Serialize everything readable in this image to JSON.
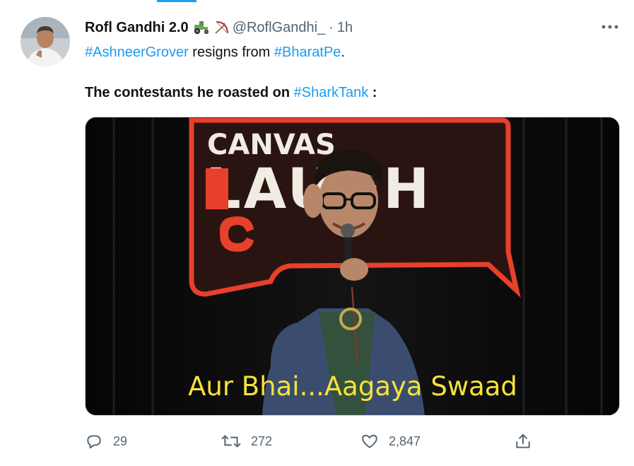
{
  "tweet": {
    "author": {
      "display_name": "Rofl Gandhi 2.0",
      "emojis": [
        "tractor-emoji",
        "bow-and-arrow-emoji"
      ],
      "handle": "@RoflGandhi_",
      "separator": "·",
      "timestamp": "1h"
    },
    "body": {
      "line1": {
        "hashtag1": "#AshneerGrover",
        "middle": " resigns from ",
        "hashtag2": "#BharatPe",
        "end": "."
      },
      "line2": {
        "text": "The contestants he roasted on ",
        "hashtag": "#SharkTank",
        "end": " :"
      }
    },
    "media": {
      "sign_top": "CANVAS",
      "sign_middle": "LAUGH",
      "caption": "Aur Bhai...Aagaya Swaad",
      "colors": {
        "sign_red": "#e8402b",
        "caption_yellow": "#f5e23c"
      }
    },
    "actions": {
      "reply_count": "29",
      "retweet_count": "272",
      "like_count": "2,847"
    },
    "colors": {
      "accent": "#1d9bf0",
      "muted": "#536471",
      "text": "#0f1419"
    }
  }
}
